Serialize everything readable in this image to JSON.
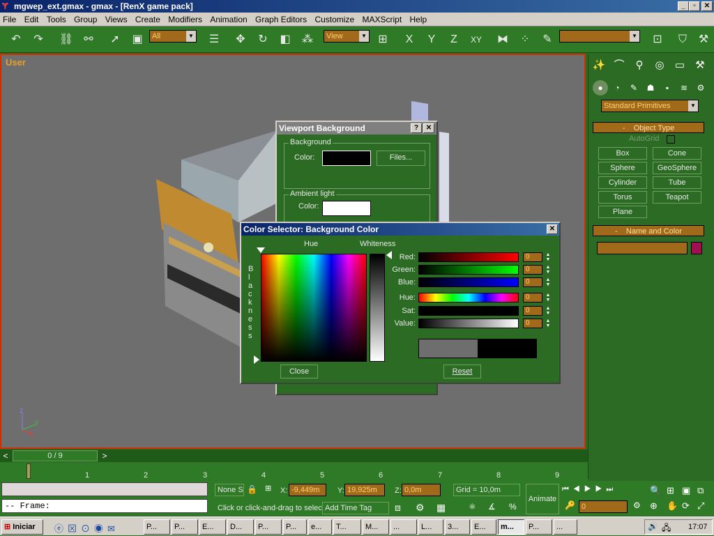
{
  "window": {
    "title": "mgwep_ext.gmax - gmax - [RenX game pack]",
    "minimize": "_",
    "maximize": "▫",
    "close": "✕"
  },
  "menu": [
    "File",
    "Edit",
    "Tools",
    "Group",
    "Views",
    "Create",
    "Modifiers",
    "Animation",
    "Graph Editors",
    "Customize",
    "MAXScript",
    "Help"
  ],
  "toolbar": {
    "selection_filter": "All",
    "ref_coord": "View",
    "named_selection": ""
  },
  "viewport": {
    "label": "User",
    "axis_labels": {
      "x": "x",
      "y": "y",
      "z": "z"
    }
  },
  "command_panel": {
    "dropdown": "Standard Primitives",
    "object_type": {
      "title": "Object Type",
      "autogrid": "AutoGrid",
      "buttons": [
        "Box",
        "Cone",
        "Sphere",
        "GeoSphere",
        "Cylinder",
        "Tube",
        "Torus",
        "Teapot",
        "Plane"
      ]
    },
    "name_color": {
      "title": "Name and Color",
      "name": "",
      "color": "#a01050"
    }
  },
  "viewport_bg_dialog": {
    "title": "Viewport Background",
    "help": "?",
    "close": "✕",
    "background_group": "Background",
    "color_label": "Color:",
    "color": "#000000",
    "files_button": "Files...",
    "ambient_group": "Ambient light",
    "ambient_color": "#ffffff"
  },
  "color_selector": {
    "title": "Color Selector: Background Color",
    "close_x": "✕",
    "hue_label": "Hue",
    "whiteness_label": "Whiteness",
    "blackness_label": "Blackness",
    "channels": [
      {
        "label": "Red:",
        "value": "0"
      },
      {
        "label": "Green:",
        "value": "0"
      },
      {
        "label": "Blue:",
        "value": "0"
      },
      {
        "label": "Hue:",
        "value": "0"
      },
      {
        "label": "Sat:",
        "value": "0"
      },
      {
        "label": "Value:",
        "value": "0"
      }
    ],
    "close_button": "Close",
    "reset_button": "Reset",
    "old_color": "#6e6e6e",
    "new_color": "#000000"
  },
  "timeline": {
    "frame_display": "0 / 9",
    "ticks": [
      "1",
      "2",
      "3",
      "4",
      "5",
      "6",
      "7",
      "8",
      "9"
    ],
    "prev": "<",
    "next": ">"
  },
  "status": {
    "maxscript_listener": "",
    "frame_line": "--  Frame:",
    "selection": "None S",
    "x_label": "X:",
    "x_value": "-9,449m",
    "y_label": "Y:",
    "y_value": "19,925m",
    "z_label": "Z:",
    "z_value": "0,0m",
    "grid": "Grid = 10,0m",
    "prompt": "Click or click-and-drag to selec",
    "add_time_tag": "Add Time Tag",
    "animate": "Animate",
    "frame_value": "0"
  },
  "taskbar": {
    "start": "Iniciar",
    "tasks": [
      "P...",
      "P...",
      "E...",
      "D...",
      "P...",
      "P...",
      "e...",
      "T...",
      "M...",
      "...",
      "L...",
      "3...",
      "E...",
      "m...",
      "P...",
      "..."
    ],
    "clock": "17:07"
  }
}
